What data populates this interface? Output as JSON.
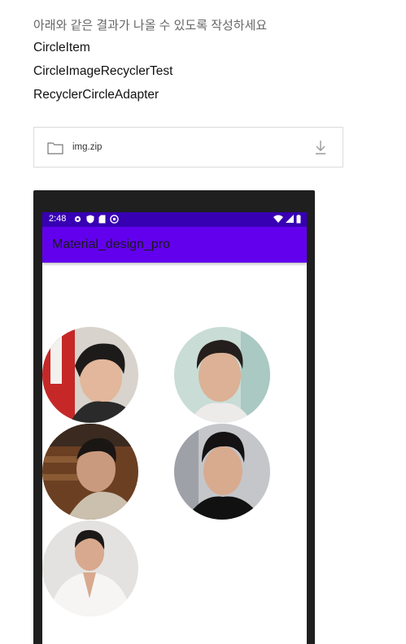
{
  "instruction": "아래와 같은 결과가 나올 수 있도록 작성하세요",
  "files_required": [
    "CircleItem",
    "CircleImageRecyclerTest",
    "RecyclerCircleAdapter"
  ],
  "attachment": {
    "name": "img.zip",
    "icon": "folder-icon",
    "action_icon": "download-icon"
  },
  "phone": {
    "status": {
      "time": "2:48",
      "left_icons": [
        "gear-icon",
        "shield-icon",
        "sd-card-icon",
        "at-sign-icon"
      ],
      "right_icons": [
        "wifi-icon",
        "signal-icon",
        "battery-icon"
      ]
    },
    "app_title": "Material_design_pro",
    "colors": {
      "statusbar": "#3700b3",
      "appbar": "#6200ee"
    },
    "circle_items": [
      "circle-item-1",
      "circle-item-2",
      "circle-item-3",
      "circle-item-4",
      "circle-item-5"
    ]
  }
}
